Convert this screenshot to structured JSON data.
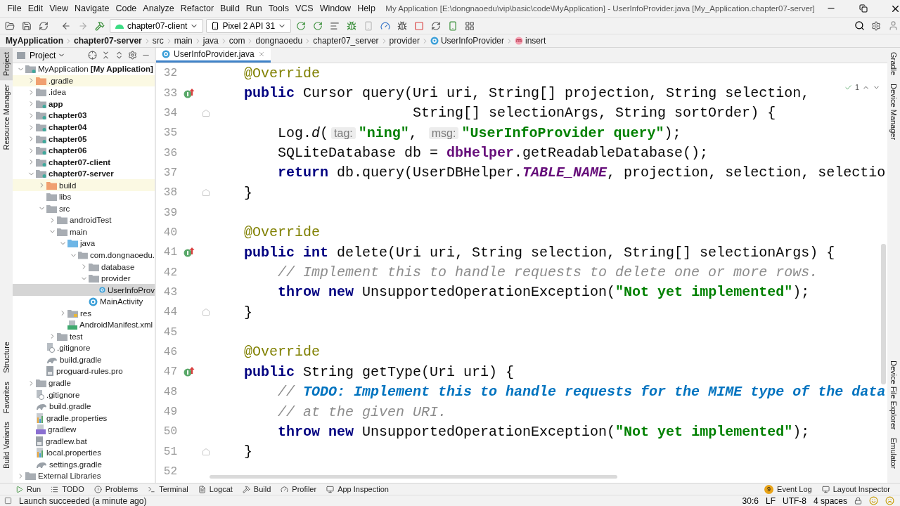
{
  "menu": [
    "File",
    "Edit",
    "View",
    "Navigate",
    "Code",
    "Analyze",
    "Refactor",
    "Build",
    "Run",
    "Tools",
    "VCS",
    "Window",
    "Help"
  ],
  "window": {
    "title": "My Application [E:\\dongnaoedu\\vip\\basic\\code\\MyApplication] - UserInfoProvider.java [My_Application.chapter07-server]"
  },
  "toolbar": {
    "run_config": "chapter07-client",
    "device": "Pixel 2 API 31"
  },
  "breadcrumbs": [
    {
      "label": "MyApplication",
      "kind": "module"
    },
    {
      "label": "chapter07-server",
      "kind": "module"
    },
    {
      "label": "src",
      "kind": "plain"
    },
    {
      "label": "main",
      "kind": "plain"
    },
    {
      "label": "java",
      "kind": "plain"
    },
    {
      "label": "com",
      "kind": "plain"
    },
    {
      "label": "dongnaoedu",
      "kind": "plain"
    },
    {
      "label": "chapter07_server",
      "kind": "plain"
    },
    {
      "label": "provider",
      "kind": "plain"
    },
    {
      "label": "UserInfoProvider",
      "kind": "class"
    },
    {
      "label": "insert",
      "kind": "method"
    }
  ],
  "left_stripe": {
    "top": [
      {
        "label": "Project",
        "selected": true
      },
      {
        "label": "Resource Manager",
        "selected": false
      }
    ],
    "bottom": [
      {
        "label": "Structure",
        "selected": false
      },
      {
        "label": "Favorites",
        "selected": false
      },
      {
        "label": "Build Variants",
        "selected": false
      }
    ]
  },
  "right_stripe": {
    "top": [
      {
        "label": "Gradle",
        "selected": false
      },
      {
        "label": "Device Manager",
        "selected": false
      }
    ],
    "bottom": [
      {
        "label": "Device File Explorer",
        "selected": false
      },
      {
        "label": "Emulator",
        "selected": false
      }
    ]
  },
  "project_panel": {
    "title": "Project",
    "tree": [
      {
        "label": "MyApplication **[My Application]**",
        "kind": "project",
        "expanded": true,
        "selected": false,
        "children": [
          {
            "label": ".gradle",
            "kind": "excluded-folder",
            "expanded": false,
            "selected": false
          },
          {
            "label": ".idea",
            "kind": "folder",
            "expanded": false,
            "selected": false
          },
          {
            "label": "app",
            "kind": "module",
            "expanded": false,
            "selected": false
          },
          {
            "label": "chapter03",
            "kind": "module",
            "expanded": false,
            "selected": false
          },
          {
            "label": "chapter04",
            "kind": "module",
            "expanded": false,
            "selected": false
          },
          {
            "label": "chapter05",
            "kind": "module",
            "expanded": false,
            "selected": false
          },
          {
            "label": "chapter06",
            "kind": "module",
            "expanded": false,
            "selected": false
          },
          {
            "label": "chapter07-client",
            "kind": "module",
            "expanded": false,
            "selected": false
          },
          {
            "label": "chapter07-server",
            "kind": "module",
            "expanded": true,
            "selected": false,
            "children": [
              {
                "label": "build",
                "kind": "excluded-folder",
                "expanded": false,
                "selected": false
              },
              {
                "label": "libs",
                "kind": "folder",
                "selected": false
              },
              {
                "label": "src",
                "kind": "folder",
                "expanded": true,
                "selected": false,
                "children": [
                  {
                    "label": "androidTest",
                    "kind": "folder",
                    "expanded": false,
                    "selected": false
                  },
                  {
                    "label": "main",
                    "kind": "folder",
                    "expanded": true,
                    "selected": false,
                    "children": [
                      {
                        "label": "java",
                        "kind": "source-folder",
                        "expanded": true,
                        "selected": false,
                        "children": [
                          {
                            "label": "com.dongnaoedu.",
                            "kind": "package",
                            "expanded": true,
                            "selected": false,
                            "children": [
                              {
                                "label": "database",
                                "kind": "package",
                                "expanded": false,
                                "selected": false
                              },
                              {
                                "label": "provider",
                                "kind": "package",
                                "expanded": true,
                                "selected": false,
                                "children": [
                                  {
                                    "label": "UserInfoProv",
                                    "kind": "java-class",
                                    "selected": true
                                  }
                                ]
                              },
                              {
                                "label": "MainActivity",
                                "kind": "java-class",
                                "selected": false
                              }
                            ]
                          }
                        ]
                      },
                      {
                        "label": "res",
                        "kind": "res-folder",
                        "expanded": false,
                        "selected": false
                      },
                      {
                        "label": "AndroidManifest.xml",
                        "kind": "manifest",
                        "selected": false
                      }
                    ]
                  },
                  {
                    "label": "test",
                    "kind": "folder",
                    "expanded": false,
                    "selected": false
                  }
                ]
              },
              {
                "label": ".gitignore",
                "kind": "gitignore",
                "selected": false
              },
              {
                "label": "build.gradle",
                "kind": "gradle",
                "selected": false
              },
              {
                "label": "proguard-rules.pro",
                "kind": "text-file",
                "selected": false
              }
            ]
          },
          {
            "label": "gradle",
            "kind": "folder",
            "expanded": false,
            "selected": false
          },
          {
            "label": ".gitignore",
            "kind": "gitignore",
            "selected": false
          },
          {
            "label": "build.gradle",
            "kind": "gradle",
            "selected": false
          },
          {
            "label": "gradle.properties",
            "kind": "properties",
            "selected": false
          },
          {
            "label": "gradlew",
            "kind": "script",
            "selected": false
          },
          {
            "label": "gradlew.bat",
            "kind": "text-file",
            "selected": false
          },
          {
            "label": "local.properties",
            "kind": "properties",
            "selected": false
          },
          {
            "label": "settings.gradle",
            "kind": "gradle",
            "selected": false
          }
        ]
      },
      {
        "label": "External Libraries",
        "kind": "library",
        "expanded": false,
        "selected": false
      }
    ]
  },
  "editor": {
    "tabs": [
      {
        "label": "UserInfoProvider.java",
        "selected": true
      }
    ],
    "inspections": "1",
    "lines": [
      {
        "number": "32",
        "kind": "code",
        "tokens": [
          {
            "kind": "annotation",
            "text": "    @Override"
          }
        ]
      },
      {
        "number": "33",
        "kind": "override",
        "tokens": [
          {
            "kind": "keyword",
            "text": "    public"
          },
          {
            "kind": "plain",
            "text": " Cursor query(Uri uri, String[] projection, String selection,"
          }
        ]
      },
      {
        "number": "34",
        "kind": "fold",
        "tokens": [
          {
            "kind": "plain",
            "text": "                        String[] selectionArgs, String sortOrder) {"
          }
        ]
      },
      {
        "number": "35",
        "kind": "code",
        "tokens": [
          {
            "kind": "plain",
            "text": "        Log."
          },
          {
            "kind": "static",
            "text": "d"
          },
          {
            "kind": "plain",
            "text": "("
          },
          {
            "kind": "hint",
            "text": "tag:"
          },
          {
            "kind": "string",
            "text": "\"ning\""
          },
          {
            "kind": "plain",
            "text": ", "
          },
          {
            "kind": "hint",
            "text": "msg:"
          },
          {
            "kind": "string",
            "text": "\"UserInfoProvider query\""
          },
          {
            "kind": "plain",
            "text": ");"
          }
        ]
      },
      {
        "number": "36",
        "kind": "code",
        "tokens": [
          {
            "kind": "plain",
            "text": "        SQLiteDatabase db = "
          },
          {
            "kind": "field",
            "text": "dbHelper"
          },
          {
            "kind": "plain",
            "text": ".getReadableDatabase();"
          }
        ]
      },
      {
        "number": "37",
        "kind": "code",
        "tokens": [
          {
            "kind": "keyword",
            "text": "        return"
          },
          {
            "kind": "plain",
            "text": " db.query(UserDBHelper."
          },
          {
            "kind": "constant",
            "text": "TABLE_NAME"
          },
          {
            "kind": "plain",
            "text": ", projection, selection, selectio"
          }
        ]
      },
      {
        "number": "38",
        "kind": "fold",
        "tokens": [
          {
            "kind": "plain",
            "text": "    }"
          }
        ]
      },
      {
        "number": "39",
        "kind": "code"
      },
      {
        "number": "40",
        "kind": "code",
        "tokens": [
          {
            "kind": "annotation",
            "text": "    @Override"
          }
        ]
      },
      {
        "number": "41",
        "kind": "override",
        "tokens": [
          {
            "kind": "keyword",
            "text": "    public int"
          },
          {
            "kind": "plain",
            "text": " delete(Uri uri, String selection, String[] selectionArgs) {"
          }
        ]
      },
      {
        "number": "42",
        "kind": "code",
        "tokens": [
          {
            "kind": "comment",
            "text": "        // Implement this to handle requests to delete one or more rows."
          }
        ]
      },
      {
        "number": "43",
        "kind": "code",
        "tokens": [
          {
            "kind": "keyword",
            "text": "        throw new"
          },
          {
            "kind": "plain",
            "text": " UnsupportedOperationException("
          },
          {
            "kind": "string",
            "text": "\"Not yet implemented\""
          },
          {
            "kind": "plain",
            "text": ");"
          }
        ]
      },
      {
        "number": "44",
        "kind": "fold",
        "tokens": [
          {
            "kind": "plain",
            "text": "    }"
          }
        ]
      },
      {
        "number": "45",
        "kind": "code"
      },
      {
        "number": "46",
        "kind": "code",
        "tokens": [
          {
            "kind": "annotation",
            "text": "    @Override"
          }
        ]
      },
      {
        "number": "47",
        "kind": "override",
        "tokens": [
          {
            "kind": "keyword",
            "text": "    public"
          },
          {
            "kind": "plain",
            "text": " String getType(Uri uri) {"
          }
        ]
      },
      {
        "number": "48",
        "kind": "code",
        "tokens": [
          {
            "kind": "comment",
            "text": "        // "
          },
          {
            "kind": "todo",
            "text": "TODO: Implement this to handle requests for the MIME type of the data"
          }
        ]
      },
      {
        "number": "49",
        "kind": "code",
        "tokens": [
          {
            "kind": "comment",
            "text": "        // at the given URI."
          }
        ]
      },
      {
        "number": "50",
        "kind": "code",
        "tokens": [
          {
            "kind": "keyword",
            "text": "        throw new"
          },
          {
            "kind": "plain",
            "text": " UnsupportedOperationException("
          },
          {
            "kind": "string",
            "text": "\"Not yet implemented\""
          },
          {
            "kind": "plain",
            "text": ");"
          }
        ]
      },
      {
        "number": "51",
        "kind": "fold",
        "tokens": [
          {
            "kind": "plain",
            "text": "    }"
          }
        ]
      },
      {
        "number": "52",
        "kind": "code"
      }
    ]
  },
  "tool_windows": {
    "left": [
      {
        "label": "Run"
      },
      {
        "label": "TODO"
      },
      {
        "label": "Problems"
      },
      {
        "label": "Terminal"
      },
      {
        "label": "Logcat"
      },
      {
        "label": "Build"
      },
      {
        "label": "Profiler"
      },
      {
        "label": "App Inspection"
      }
    ],
    "right": [
      {
        "label": "Event Log",
        "badge": "9"
      },
      {
        "label": "Layout Inspector"
      }
    ]
  },
  "status_bar": {
    "message": "Launch succeeded (a minute ago)",
    "items": [
      "30:6",
      "LF",
      "UTF-8",
      "4 spaces"
    ]
  }
}
